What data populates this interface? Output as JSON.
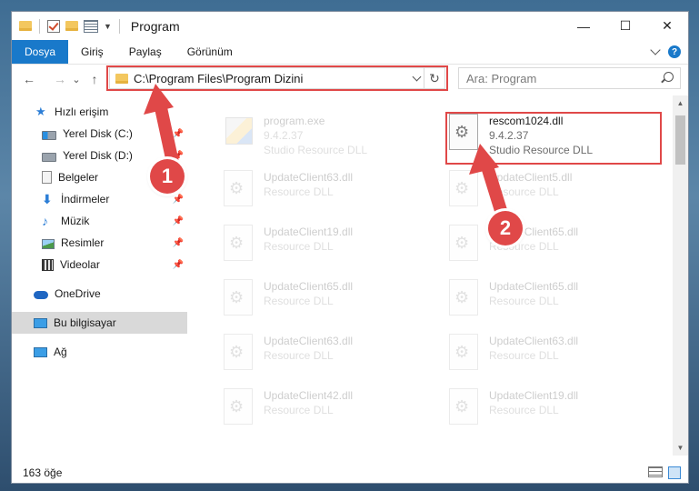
{
  "window": {
    "title": "Program",
    "controls": {
      "minimize": "—",
      "maximize": "☐",
      "close": "✕"
    }
  },
  "ribbon": {
    "tabs": [
      {
        "label": "Dosya",
        "active": true
      },
      {
        "label": "Giriş"
      },
      {
        "label": "Paylaş"
      },
      {
        "label": "Görünüm"
      }
    ],
    "help": "?"
  },
  "navigation": {
    "back": "←",
    "forward": "→",
    "recent": "⌄",
    "up": "↑",
    "refresh": "↻",
    "address": "C:\\Program Files\\Program Dizini",
    "search_placeholder": "Ara: Program"
  },
  "nav_pane": {
    "items": [
      {
        "label": "Hızlı erişim",
        "icon": "star-icon"
      },
      {
        "label": "Yerel Disk (C:)",
        "icon": "drive-c-icon",
        "pinned": true
      },
      {
        "label": "Yerel Disk (D:)",
        "icon": "drive-d-icon",
        "pinned": true
      },
      {
        "label": "Belgeler",
        "icon": "documents-icon",
        "pinned": true
      },
      {
        "label": "İndirmeler",
        "icon": "downloads-icon",
        "pinned": true
      },
      {
        "label": "Müzik",
        "icon": "music-icon",
        "pinned": true
      },
      {
        "label": "Resimler",
        "icon": "pictures-icon",
        "pinned": true
      },
      {
        "label": "Videolar",
        "icon": "videos-icon",
        "pinned": true
      },
      {
        "label": "OneDrive",
        "icon": "onedrive-icon"
      },
      {
        "label": "Bu bilgisayar",
        "icon": "this-pc-icon",
        "selected": true
      },
      {
        "label": "Ağ",
        "icon": "network-icon"
      }
    ],
    "pin_glyph": "📌"
  },
  "files": [
    {
      "name": "program.exe",
      "version": "9.4.2.37",
      "description": "Studio Resource DLL",
      "type": "exe",
      "faded": true
    },
    {
      "name": "rescom1024.dll",
      "version": "9.4.2.37",
      "description": "Studio Resource DLL",
      "type": "dll",
      "faded": false
    },
    {
      "name": "UpdateClient63.dll",
      "description": "Resource DLL",
      "type": "dll",
      "faded": true
    },
    {
      "name": "UpdateClient5.dll",
      "description": "Resource DLL",
      "type": "dll",
      "faded": true
    },
    {
      "name": "UpdateClient19.dll",
      "description": "Resource DLL",
      "type": "dll",
      "faded": true
    },
    {
      "name": "UpdateClient65.dll",
      "description": "Resource DLL",
      "type": "dll",
      "faded": true
    },
    {
      "name": "UpdateClient65.dll",
      "description": "Resource DLL",
      "type": "dll",
      "faded": true
    },
    {
      "name": "UpdateClient65.dll",
      "description": "Resource DLL",
      "type": "dll",
      "faded": true
    },
    {
      "name": "UpdateClient63.dll",
      "description": "Resource DLL",
      "type": "dll",
      "faded": true
    },
    {
      "name": "UpdateClient63.dll",
      "description": "Resource DLL",
      "type": "dll",
      "faded": true
    },
    {
      "name": "UpdateClient42.dll",
      "description": "Resource DLL",
      "type": "dll",
      "faded": true
    },
    {
      "name": "UpdateClient19.dll",
      "description": "Resource DLL",
      "type": "dll",
      "faded": true
    }
  ],
  "status": {
    "count": "163 öğe"
  },
  "annotations": {
    "step1": "1",
    "step2": "2",
    "color": "#e04848"
  },
  "colors": {
    "accent": "#1979ca",
    "highlight": "#e04848"
  }
}
